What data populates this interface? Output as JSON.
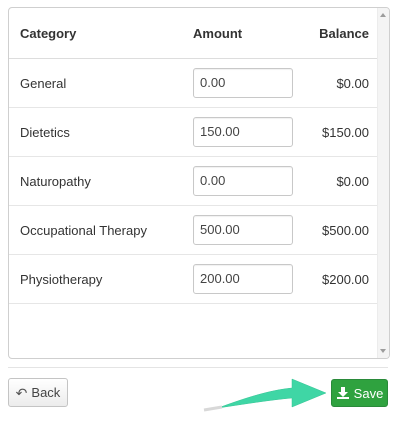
{
  "table": {
    "headers": {
      "category": "Category",
      "amount": "Amount",
      "balance": "Balance"
    },
    "rows": [
      {
        "category": "General",
        "amount": "0.00",
        "balance": "$0.00"
      },
      {
        "category": "Dietetics",
        "amount": "150.00",
        "balance": "$150.00"
      },
      {
        "category": "Naturopathy",
        "amount": "0.00",
        "balance": "$0.00"
      },
      {
        "category": "Occupational Therapy",
        "amount": "500.00",
        "balance": "$500.00"
      },
      {
        "category": "Physiotherapy",
        "amount": "200.00",
        "balance": "$200.00"
      }
    ]
  },
  "buttons": {
    "back_label": "Back",
    "save_label": "Save"
  },
  "icons": {
    "back": "reply-arrow-icon",
    "save": "download-icon",
    "annotation": "pointer-arrow"
  },
  "colors": {
    "save_bg": "#2fa23f",
    "annotation_arrow": "#3fd6a5"
  }
}
